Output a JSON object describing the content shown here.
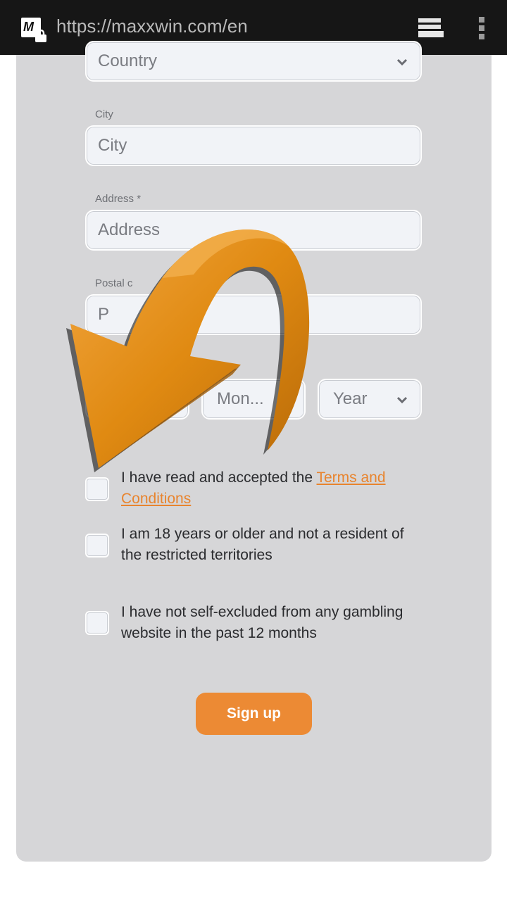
{
  "browser": {
    "url": "https://maxxwin.com/en",
    "favicon_letter": "M"
  },
  "form": {
    "country": {
      "placeholder": "Country"
    },
    "city": {
      "label": "City",
      "placeholder": "City"
    },
    "address": {
      "label": "Address *",
      "placeholder": "Address"
    },
    "postal": {
      "label": "Postal c",
      "placeholder": "P"
    },
    "dob": {
      "month": "Mon...",
      "year": "Year"
    },
    "checks": {
      "terms_prefix": "I have read and accepted the ",
      "terms_link": "Terms and Conditions",
      "age": "I am 18 years or older and not a resident of the restricted territories",
      "self_excluded": "I have not self-excluded from any gambling website in the past 12 months"
    },
    "signup_label": "Sign up"
  },
  "colors": {
    "topbar": "#161616",
    "card": "#d6d6d8",
    "accent": "#ec8a34",
    "link": "#e8842e",
    "arrow": "#e08a12"
  },
  "icons": {
    "tabs": "tabs-icon",
    "menu": "kebab-menu-icon",
    "lock": "lock-icon",
    "chevron": "chevron-down-icon",
    "overlay": "curved-arrow-icon"
  }
}
